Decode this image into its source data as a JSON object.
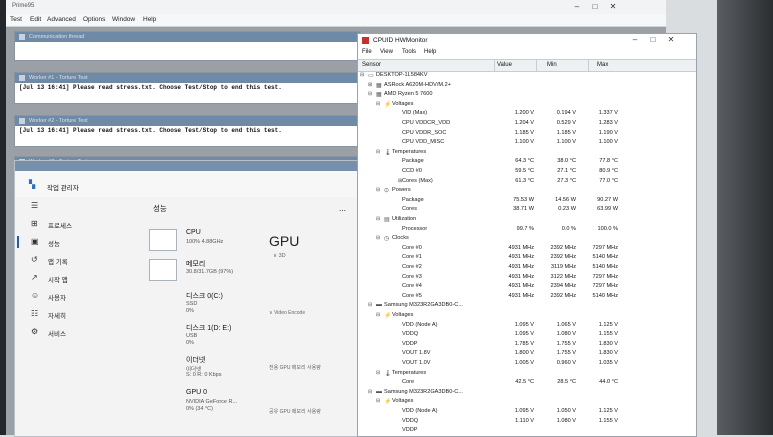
{
  "prime95": {
    "title": "Prime95",
    "menu": [
      "Test",
      "Edit",
      "Advanced",
      "Options",
      "Window",
      "Help"
    ],
    "comm_title": "Communication thread",
    "worker1_title": "Worker #1 - Torture Test",
    "worker1_line": "[Jul 13 16:41] Please read stress.txt.  Choose Test/Stop to end this test.",
    "worker2_title": "Worker #2 - Torture Test",
    "worker2_line": "[Jul 13 16:41] Please read stress.txt.  Choose Test/Stop to end this test.",
    "worker3_title": "Worker #3 - Torture Test"
  },
  "taskmgr": {
    "title": "작업 관리자",
    "nav": [
      {
        "icon": "☰",
        "label": ""
      },
      {
        "icon": "⊞",
        "label": "프로세스"
      },
      {
        "icon": "▣",
        "label": "성능"
      },
      {
        "icon": "↺",
        "label": "앱 기록"
      },
      {
        "icon": "↗",
        "label": "시작 앱"
      },
      {
        "icon": "☺",
        "label": "사용자"
      },
      {
        "icon": "☷",
        "label": "자세히"
      },
      {
        "icon": "⚙",
        "label": "서비스"
      }
    ],
    "perf_title": "성능",
    "items": [
      {
        "name": "CPU",
        "s1": "100% 4.88GHz",
        "s2": ""
      },
      {
        "name": "메모리",
        "s1": "30.8/31.7GB (97%)",
        "s2": ""
      },
      {
        "name": "디스크 0(C:)",
        "s1": "SSD",
        "s2": "0%"
      },
      {
        "name": "디스크 1(D: E:)",
        "s1": "USB",
        "s2": "0%"
      },
      {
        "name": "이더넷",
        "s1": "이더넷",
        "s2": "S: 0  R: 0 Kbps"
      },
      {
        "name": "GPU 0",
        "s1": "NVIDIA GeForce R...",
        "s2": "0% (34 °C)"
      }
    ],
    "gpu_heading": "GPU",
    "gpu_3d": "3D",
    "gpu_video_encode": "Video Encode",
    "gpu_dedicated": "전용 GPU 메모리 사용량",
    "gpu_shared": "공유 GPU 메모리 사용량"
  },
  "hwmon": {
    "title": "CPUID HWMonitor",
    "menu": [
      "File",
      "View",
      "Tools",
      "Help"
    ],
    "cols": [
      "Sensor",
      "Value",
      "Min",
      "Max"
    ],
    "rows": [
      {
        "lvl": 0,
        "exp": "⊟",
        "icon": "▭",
        "label": "DESKTOP-1L584KV",
        "v": "",
        "mn": "",
        "mx": ""
      },
      {
        "lvl": 1,
        "exp": "⊞",
        "icon": "▦",
        "label": "ASRock A620M-HDV/M.2+",
        "v": "",
        "mn": "",
        "mx": ""
      },
      {
        "lvl": 1,
        "exp": "⊟",
        "icon": "▦",
        "label": "AMD Ryzen 5 7600",
        "v": "",
        "mn": "",
        "mx": ""
      },
      {
        "lvl": 2,
        "exp": "⊟",
        "icon": "⚡",
        "label": "Voltages",
        "v": "",
        "mn": "",
        "mx": ""
      },
      {
        "lvl": 3,
        "exp": "",
        "icon": "",
        "label": "VID (Max)",
        "v": "1.200 V",
        "mn": "0.194 V",
        "mx": "1.337 V"
      },
      {
        "lvl": 3,
        "exp": "",
        "icon": "",
        "label": "CPU VDDCR_VDD",
        "v": "1.204 V",
        "mn": "0.529 V",
        "mx": "1.283 V"
      },
      {
        "lvl": 3,
        "exp": "",
        "icon": "",
        "label": "CPU VDDR_SOC",
        "v": "1.185 V",
        "mn": "1.185 V",
        "mx": "1.190 V"
      },
      {
        "lvl": 3,
        "exp": "",
        "icon": "",
        "label": "CPU VDD_MISC",
        "v": "1.100 V",
        "mn": "1.100 V",
        "mx": "1.100 V"
      },
      {
        "lvl": 2,
        "exp": "⊟",
        "icon": "🌡",
        "label": "Temperatures",
        "v": "",
        "mn": "",
        "mx": ""
      },
      {
        "lvl": 3,
        "exp": "",
        "icon": "",
        "label": "Package",
        "v": "64.3 °C",
        "mn": "38.0 °C",
        "mx": "77.8 °C"
      },
      {
        "lvl": 3,
        "exp": "",
        "icon": "",
        "label": "CCD #0",
        "v": "59.5 °C",
        "mn": "27.1 °C",
        "mx": "80.9 °C"
      },
      {
        "lvl": 3,
        "exp": "⊞",
        "icon": "",
        "label": "Cores (Max)",
        "v": "61.3 °C",
        "mn": "27.3 °C",
        "mx": "77.0 °C"
      },
      {
        "lvl": 2,
        "exp": "⊟",
        "icon": "⊙",
        "label": "Powers",
        "v": "",
        "mn": "",
        "mx": ""
      },
      {
        "lvl": 3,
        "exp": "",
        "icon": "",
        "label": "Package",
        "v": "75.53 W",
        "mn": "14.56 W",
        "mx": "90.27 W"
      },
      {
        "lvl": 3,
        "exp": "",
        "icon": "",
        "label": "Cores",
        "v": "38.71 W",
        "mn": "0.23 W",
        "mx": "63.99 W"
      },
      {
        "lvl": 2,
        "exp": "⊟",
        "icon": "▤",
        "label": "Utilization",
        "v": "",
        "mn": "",
        "mx": ""
      },
      {
        "lvl": 3,
        "exp": "",
        "icon": "",
        "label": "Processor",
        "v": "99.7 %",
        "mn": "0.0 %",
        "mx": "100.0 %"
      },
      {
        "lvl": 2,
        "exp": "⊟",
        "icon": "◷",
        "label": "Clocks",
        "v": "",
        "mn": "",
        "mx": ""
      },
      {
        "lvl": 3,
        "exp": "",
        "icon": "",
        "label": "Core #0",
        "v": "4931 MHz",
        "mn": "2392 MHz",
        "mx": "7297 MHz"
      },
      {
        "lvl": 3,
        "exp": "",
        "icon": "",
        "label": "Core #1",
        "v": "4931 MHz",
        "mn": "2392 MHz",
        "mx": "5140 MHz"
      },
      {
        "lvl": 3,
        "exp": "",
        "icon": "",
        "label": "Core #2",
        "v": "4931 MHz",
        "mn": "3119 MHz",
        "mx": "5140 MHz"
      },
      {
        "lvl": 3,
        "exp": "",
        "icon": "",
        "label": "Core #3",
        "v": "4931 MHz",
        "mn": "3122 MHz",
        "mx": "7297 MHz"
      },
      {
        "lvl": 3,
        "exp": "",
        "icon": "",
        "label": "Core #4",
        "v": "4931 MHz",
        "mn": "2394 MHz",
        "mx": "7297 MHz"
      },
      {
        "lvl": 3,
        "exp": "",
        "icon": "",
        "label": "Core #5",
        "v": "4931 MHz",
        "mn": "2392 MHz",
        "mx": "5140 MHz"
      },
      {
        "lvl": 1,
        "exp": "⊟",
        "icon": "▬",
        "label": "Samsung M323R2GA3DB0-C...",
        "v": "",
        "mn": "",
        "mx": ""
      },
      {
        "lvl": 2,
        "exp": "⊟",
        "icon": "⚡",
        "label": "Voltages",
        "v": "",
        "mn": "",
        "mx": ""
      },
      {
        "lvl": 3,
        "exp": "",
        "icon": "",
        "label": "VDD (Node A)",
        "v": "1.095 V",
        "mn": "1.065 V",
        "mx": "1.125 V"
      },
      {
        "lvl": 3,
        "exp": "",
        "icon": "",
        "label": "VDDQ",
        "v": "1.095 V",
        "mn": "1.080 V",
        "mx": "1.155 V"
      },
      {
        "lvl": 3,
        "exp": "",
        "icon": "",
        "label": "VDDP",
        "v": "1.785 V",
        "mn": "1.755 V",
        "mx": "1.830 V"
      },
      {
        "lvl": 3,
        "exp": "",
        "icon": "",
        "label": "VOUT 1.8V",
        "v": "1.800 V",
        "mn": "1.755 V",
        "mx": "1.830 V"
      },
      {
        "lvl": 3,
        "exp": "",
        "icon": "",
        "label": "VOUT 1.0V",
        "v": "1.005 V",
        "mn": "0.960 V",
        "mx": "1.035 V"
      },
      {
        "lvl": 2,
        "exp": "⊟",
        "icon": "🌡",
        "label": "Temperatures",
        "v": "",
        "mn": "",
        "mx": ""
      },
      {
        "lvl": 3,
        "exp": "",
        "icon": "",
        "label": "Core",
        "v": "42.5 °C",
        "mn": "28.5 °C",
        "mx": "44.0 °C"
      },
      {
        "lvl": 1,
        "exp": "⊟",
        "icon": "▬",
        "label": "Samsung M323R2GA3DB0-C...",
        "v": "",
        "mn": "",
        "mx": ""
      },
      {
        "lvl": 2,
        "exp": "⊟",
        "icon": "⚡",
        "label": "Voltages",
        "v": "",
        "mn": "",
        "mx": ""
      },
      {
        "lvl": 3,
        "exp": "",
        "icon": "",
        "label": "VDD (Node A)",
        "v": "1.095 V",
        "mn": "1.050 V",
        "mx": "1.125 V"
      },
      {
        "lvl": 3,
        "exp": "",
        "icon": "",
        "label": "VDDQ",
        "v": "1.110 V",
        "mn": "1.080 V",
        "mx": "1.155 V"
      },
      {
        "lvl": 3,
        "exp": "",
        "icon": "",
        "label": "VDDP",
        "v": "",
        "mn": "",
        "mx": ""
      }
    ]
  }
}
